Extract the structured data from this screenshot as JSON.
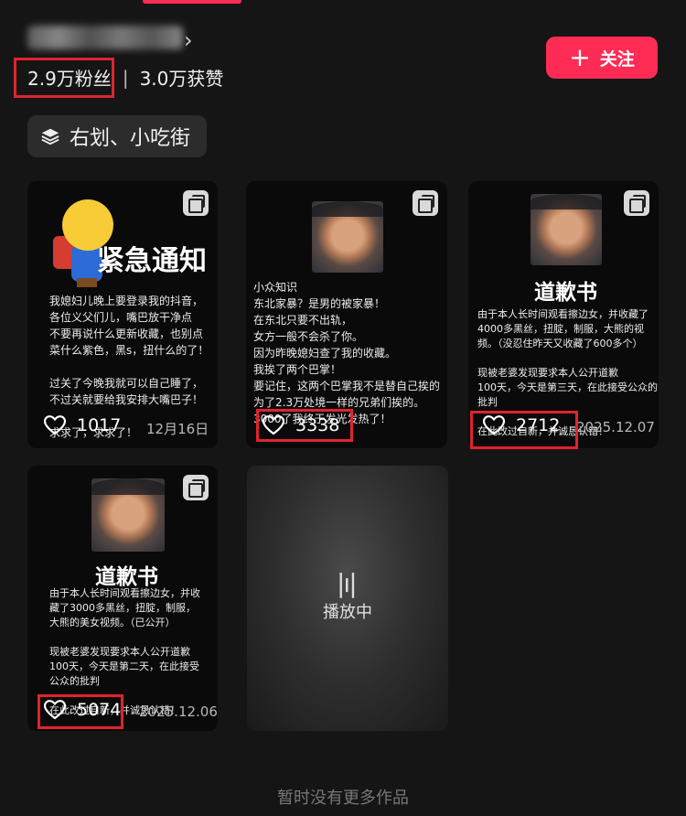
{
  "profile": {
    "followers": "2.9万粉丝",
    "separator": "|",
    "likes_total": "3.0万获赞",
    "follow_label": "关注",
    "collection_label": "右划、小吃街"
  },
  "cards": [
    {
      "headline": "紧急通知",
      "body": "我媳妇儿晚上要登录我的抖音，\n各位义父们儿，嘴巴放干净点\n不要再说什么更新收藏，也别点\n菜什么紫色，黑s，扭什么的了！\n\n过关了今晚我就可以自己睡了，\n不过关就要给我安排大嘴巴子！\n\n求求了，求求了！",
      "likes": "1017",
      "date": "12月16日"
    },
    {
      "body": "小众知识\n东北家暴？是男的被家暴！\n在东北只要不出轨，\n女方一般不会杀了你。\n因为昨晚媳妇查了我的收藏。\n我挨了两个巴掌！\n要记住，这两个巴掌我不是替自己挨的\n为了2.3万处境一样的兄弟们挨的。\n3000了我终于发光发热了！",
      "likes": "3338"
    },
    {
      "headline": "道歉书",
      "body": "由于本人长时间观看擦边女，并收藏了\n4000多黑丝，扭腚，制服，大熊的视\n频。（没忍住昨天又收藏了600多个）\n\n现被老婆发现要求本人公开道歉\n100天，今天是第三天，在此接受公众的\n批判\n\n在此改过自新，并诚恳认错！",
      "likes": "2712",
      "date": "2025.12.07"
    },
    {
      "headline": "道歉书",
      "body": "由于本人长时间观看擦边女，并收\n藏了3000多黑丝，扭腚，制服，\n大熊的美女视频。（已公开）\n\n现被老婆发现要求本人公开道歉\n100天，今天是第二天，在此接受\n公众的批判\n\n在此改过自新，并诚恳认错！",
      "likes": "5074",
      "date": "2025.12.06"
    }
  ],
  "playing": {
    "label": "播放中"
  },
  "footer": {
    "no_more": "暂时没有更多作品"
  },
  "colors": {
    "accent": "#fe2c55",
    "highlight_box": "#e0232d",
    "background": "#151515"
  }
}
